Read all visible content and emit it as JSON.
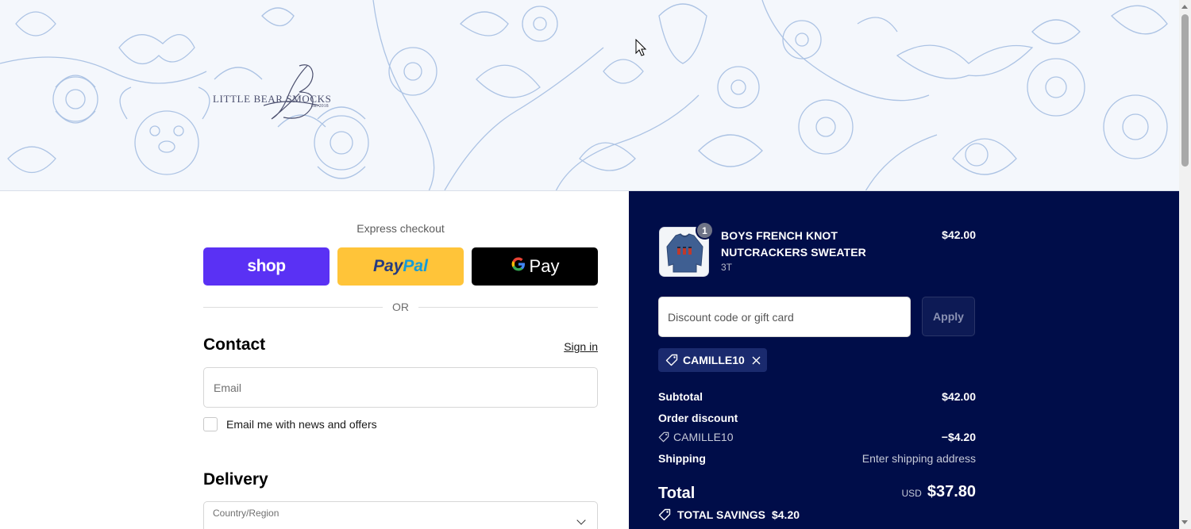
{
  "header": {
    "logo_brand": "LITTLE BEAR SMOCKS",
    "logo_est": "est. 2018",
    "logo_icon": "script-monogram-logo"
  },
  "express": {
    "label": "Express checkout",
    "shop_label": "shop",
    "paypal_label_1": "Pay",
    "paypal_label_2": "Pal",
    "gpay_g": "G",
    "gpay_label": "Pay",
    "or_label": "OR"
  },
  "contact": {
    "title": "Contact",
    "signin_label": "Sign in",
    "email_placeholder": "Email",
    "newsletter_label": "Email me with news and offers"
  },
  "delivery": {
    "title": "Delivery",
    "country_label": "Country/Region"
  },
  "order": {
    "item": {
      "quantity": "1",
      "name": "BOYS FRENCH KNOT NUTCRACKERS SWEATER",
      "variant": "3T",
      "price": "$42.00",
      "image_icon": "sweater-thumbnail"
    },
    "discount_placeholder": "Discount code or gift card",
    "apply_label": "Apply",
    "applied_code": "CAMILLE10",
    "subtotal_label": "Subtotal",
    "subtotal_value": "$42.00",
    "order_discount_label": "Order discount",
    "discount_code_label": "CAMILLE10",
    "discount_value": "−$4.20",
    "shipping_label": "Shipping",
    "shipping_value": "Enter shipping address",
    "total_label": "Total",
    "total_currency": "USD",
    "total_value": "$37.80",
    "savings_label": "TOTAL SAVINGS",
    "savings_value": "$4.20"
  },
  "colors": {
    "summary_bg": "#000d49",
    "shop_pay": "#5a31f4",
    "paypal": "#ffc439",
    "gpay": "#000000",
    "banner_pattern": "#a9c1e3"
  }
}
